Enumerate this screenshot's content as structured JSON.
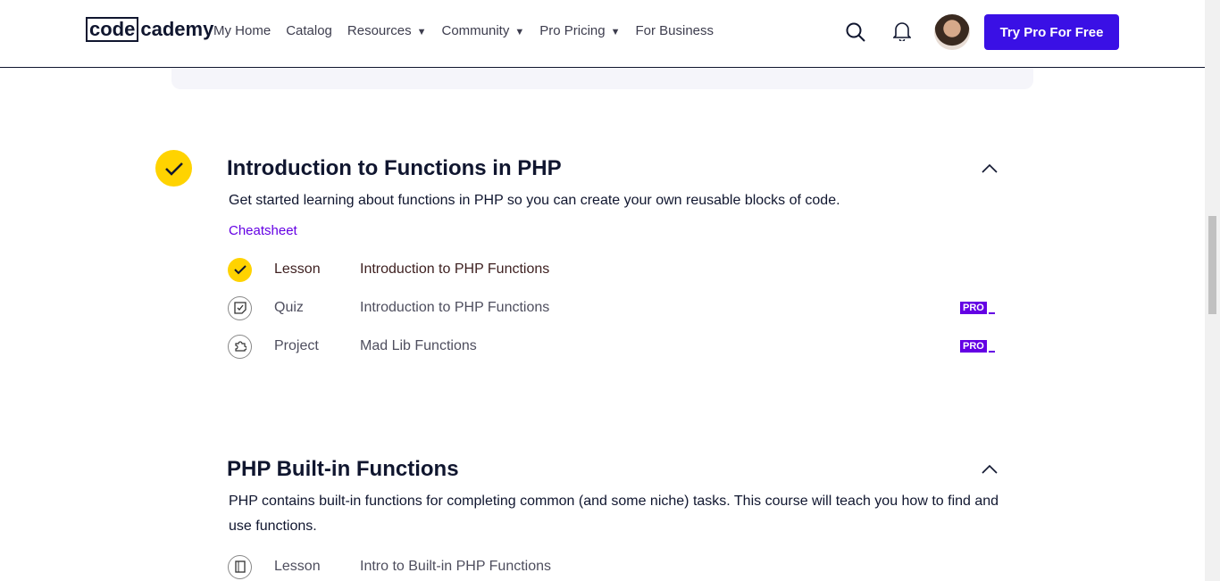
{
  "nav": {
    "logo_box": "code",
    "logo_rest": "cademy",
    "links": [
      "My Home",
      "Catalog",
      "Resources",
      "Community",
      "Pro Pricing",
      "For Business"
    ],
    "cta": "Try Pro For Free"
  },
  "modules": [
    {
      "title": "Introduction to Functions in PHP",
      "description": "Get started learning about functions in PHP so you can create your own reusable blocks of code.",
      "cheatsheet": "Cheatsheet",
      "items": [
        {
          "type": "Lesson",
          "title": "Introduction to PHP Functions"
        },
        {
          "type": "Quiz",
          "title": "Introduction to PHP Functions",
          "badge": "PRO"
        },
        {
          "type": "Project",
          "title": "Mad Lib Functions",
          "badge": "PRO"
        }
      ]
    },
    {
      "title": "PHP Built-in Functions",
      "description": "PHP contains built-in functions for completing common (and some niche) tasks. This course will teach you how to find and use functions.",
      "items": [
        {
          "type": "Lesson",
          "title": "Intro to Built-in PHP Functions"
        }
      ]
    }
  ]
}
